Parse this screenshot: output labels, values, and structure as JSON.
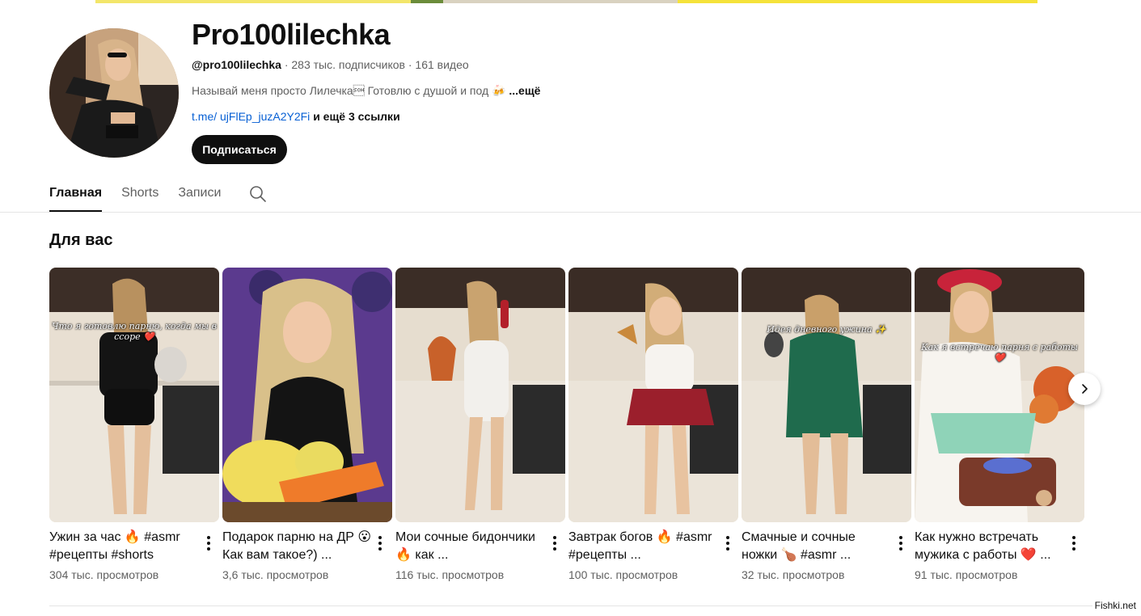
{
  "channel": {
    "name": "Pro100lilechka",
    "handle": "@pro100lilechka",
    "subscribers": "· 283 тыс. подписчиков",
    "videos": "· 161 видео",
    "description": "Называй меня просто Лилечка\u0001 Готовлю с душой и под 🍻",
    "description_more": "...ещё",
    "link": "t.me/ ujFlEp_juzA2Y2Fi",
    "more_links": "и ещё 3 ссылки",
    "subscribe_label": "Подписаться"
  },
  "tabs": [
    {
      "label": "Главная",
      "active": true
    },
    {
      "label": "Shorts",
      "active": false
    },
    {
      "label": "Записи",
      "active": false
    }
  ],
  "icons": {
    "tab_search": "search-icon",
    "card_menu": "more-vert-icon",
    "shelf_next": "chevron-right-icon"
  },
  "section": {
    "title": "Для вас"
  },
  "cards": [
    {
      "title": "Ужин за час 🔥 #asmr #рецепты #shorts",
      "views": "304 тыс. просмотров",
      "caption": "Что я готовлю парню, когда мы в ссоре ❤️"
    },
    {
      "title": "Подарок парню на ДР 😮 Как вам такое?) ...",
      "views": "3,6 тыс. просмотров",
      "caption": ""
    },
    {
      "title": "Мои сочные бидончики 🔥 как ...",
      "views": "116 тыс. просмотров",
      "caption": ""
    },
    {
      "title": "Завтрак богов 🔥 #asmr #рецепты ...",
      "views": "100 тыс. просмотров",
      "caption": ""
    },
    {
      "title": "Смачные и сочные ножки 🍗 #asmr ...",
      "views": "32 тыс. просмотров",
      "caption": "Идея дневного ужина ✨"
    },
    {
      "title": "Как нужно встречать мужика с работы ❤️ ...",
      "views": "91 тыс. просмотров",
      "caption": "Как я встречаю парня с работы ❤️"
    }
  ],
  "colors": {
    "text_primary": "#0f0f0f",
    "text_secondary": "#606060",
    "link": "#065fd4",
    "subscribe_bg": "#0f0f0f",
    "banner_yellow": "#f5e23a"
  },
  "watermark": "Fishki.net"
}
